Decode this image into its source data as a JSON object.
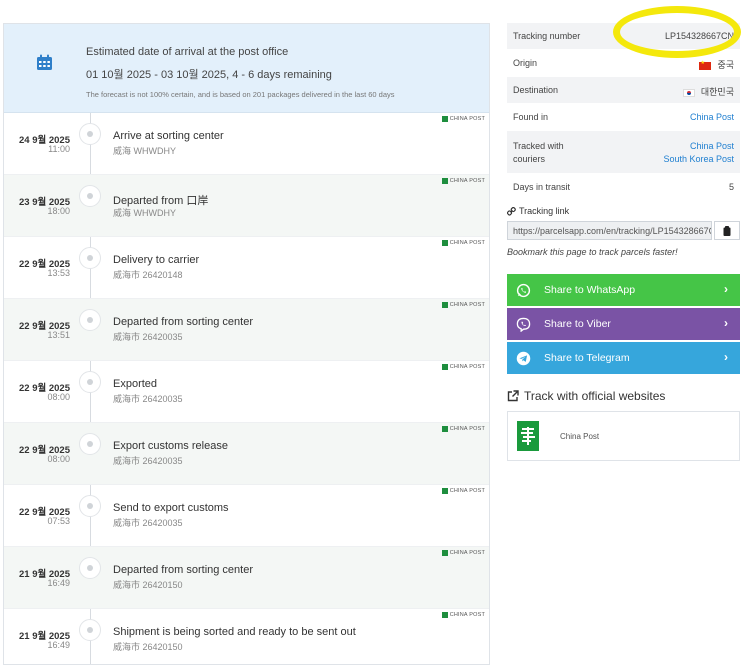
{
  "eta": {
    "title": "Estimated date of arrival at the post office",
    "range": "01 10월 2025 - 03 10월 2025, 4 - 6 days remaining",
    "note": "The forecast is not 100% certain, and is based on 201 packages delivered in the last 60 days",
    "icon": "calendar-icon"
  },
  "events": [
    {
      "date": "24 9월 2025",
      "time": "11:00",
      "status": "Arrive at sorting center",
      "location": "威海 WHWDHY",
      "courier": "CHINA POST"
    },
    {
      "date": "23 9월 2025",
      "time": "18:00",
      "status": "Departed from 口岸",
      "location": "威海 WHWDHY",
      "courier": "CHINA POST"
    },
    {
      "date": "22 9월 2025",
      "time": "13:53",
      "status": "Delivery to carrier",
      "location": "威海市 26420148",
      "courier": "CHINA POST"
    },
    {
      "date": "22 9월 2025",
      "time": "13:51",
      "status": "Departed from sorting center",
      "location": "威海市 26420035",
      "courier": "CHINA POST"
    },
    {
      "date": "22 9월 2025",
      "time": "08:00",
      "status": "Exported",
      "location": "威海市 26420035",
      "courier": "CHINA POST"
    },
    {
      "date": "22 9월 2025",
      "time": "08:00",
      "status": "Export customs release",
      "location": "威海市 26420035",
      "courier": "CHINA POST"
    },
    {
      "date": "22 9월 2025",
      "time": "07:53",
      "status": "Send to export customs",
      "location": "威海市 26420035",
      "courier": "CHINA POST"
    },
    {
      "date": "21 9월 2025",
      "time": "16:49",
      "status": "Departed from sorting center",
      "location": "威海市 26420150",
      "courier": "CHINA POST"
    },
    {
      "date": "21 9월 2025",
      "time": "16:49",
      "status": "Shipment is being sorted and ready to be sent out",
      "location": "威海市 26420150",
      "courier": "CHINA POST"
    }
  ],
  "info": {
    "tracking_number_label": "Tracking number",
    "tracking_number": "LP154328667CN",
    "origin_label": "Origin",
    "origin": "중국",
    "destination_label": "Destination",
    "destination": "대한민국",
    "found_in_label": "Found in",
    "found_in": "China Post",
    "tracked_with_label_1": "Tracked with",
    "tracked_with_label_2": "couriers",
    "tracked_with_1": "China Post",
    "tracked_with_2": "South Korea Post",
    "days_label": "Days in transit",
    "days": "5"
  },
  "tracking_link": {
    "title": "Tracking link",
    "url": "https://parcelsapp.com/en/tracking/LP154328667CN",
    "bookmark": "Bookmark this page to track parcels faster!"
  },
  "share": {
    "whatsapp": "Share to WhatsApp",
    "viber": "Share to Viber",
    "telegram": "Share to Telegram",
    "colors": {
      "whatsapp": "#45c547",
      "viber": "#7a53a5",
      "telegram": "#36a6dc"
    }
  },
  "official": {
    "title": "Track with official websites",
    "site": "China Post"
  },
  "colors": {
    "accent_link": "#1f7fd0",
    "highlight": "#f4e80c",
    "eta_bg": "#e3f0fb"
  }
}
